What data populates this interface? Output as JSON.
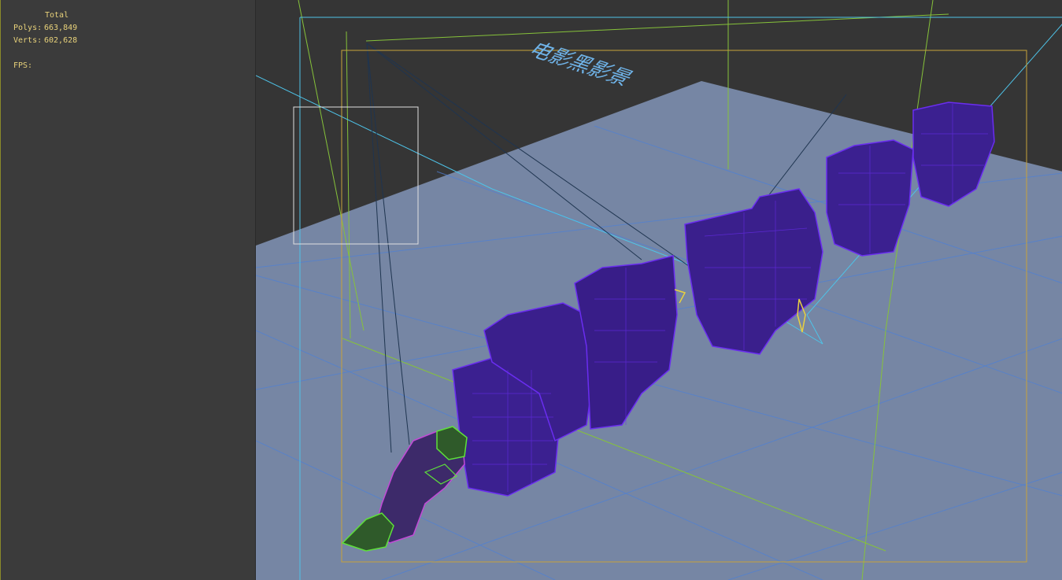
{
  "stats": {
    "total_label": "Total",
    "polys_label": "Polys:",
    "polys_value": "663,849",
    "verts_label": "Verts:",
    "verts_value": "602,628",
    "fps_label": "FPS:"
  },
  "viewport": {
    "ground_text": "电影黑影景",
    "colors": {
      "background": "#353535",
      "ground_plane": "#7a8aa8",
      "grid_line": "#4a7fd6",
      "camera_line": "#4ec3e8",
      "green_line": "#86c23a",
      "safe_frame": "#c8a23a",
      "mesh_fill": "#3d1f8a",
      "mesh_wire": "#6a2df0",
      "creature_magenta": "#c24ad6",
      "creature_green": "#5ee03a"
    },
    "icons": [
      "camera-frustum",
      "selection-box",
      "light-gizmo",
      "target-gizmo"
    ]
  }
}
